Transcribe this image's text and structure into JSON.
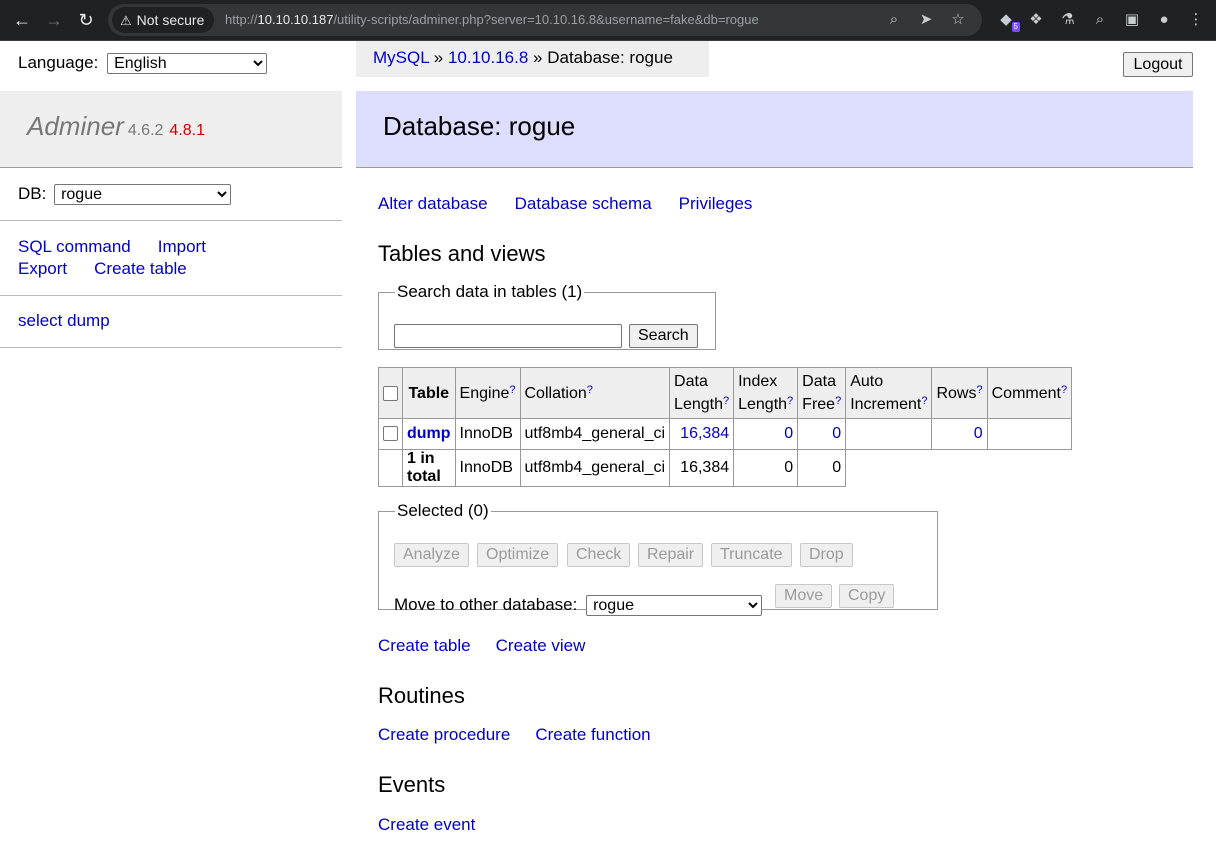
{
  "browser": {
    "security_label": "Not secure",
    "url_scheme": "http://",
    "url_host": "10.10.10.187",
    "url_path": "/utility-scripts/adminer.php?server=10.10.16.8&username=fake&db=rogue",
    "extension_badge": "5"
  },
  "language": {
    "label": "Language:",
    "selected": "English"
  },
  "breadcrumb": {
    "mysql": "MySQL",
    "sep1": " » ",
    "server": "10.10.16.8",
    "sep2": " » Database: rogue"
  },
  "logout_label": "Logout",
  "sidebar": {
    "brand": "Adminer",
    "version": "4.6.2",
    "new_version": "4.8.1",
    "db_label": "DB:",
    "db_selected": "rogue",
    "links": {
      "sql_command": "SQL command",
      "import": "Import",
      "export": "Export",
      "create_table": "Create table"
    },
    "select_dump": "select dump"
  },
  "content": {
    "heading": "Database: rogue",
    "top_links": {
      "alter": "Alter database",
      "schema": "Database schema",
      "privileges": "Privileges"
    },
    "tables_heading": "Tables and views",
    "search": {
      "legend": "Search data in tables (1)",
      "button": "Search",
      "value": ""
    },
    "table": {
      "headers": {
        "table": "Table",
        "engine": "Engine",
        "collation": "Collation",
        "data_length_1": "Data",
        "data_length_2": "Length",
        "index_length_1": "Index",
        "index_length_2": "Length",
        "data_free_1": "Data",
        "data_free_2": "Free",
        "auto_inc_1": "Auto",
        "auto_inc_2": "Increment",
        "rows": "Rows",
        "comment": "Comment",
        "help": "?"
      },
      "row": {
        "name": "dump",
        "engine": "InnoDB",
        "collation": "utf8mb4_general_ci",
        "data_length": "16,384",
        "index_length": "0",
        "data_free": "0",
        "auto_increment": "",
        "rows": "0",
        "comment": ""
      },
      "total": {
        "label": "1 in total",
        "engine": "InnoDB",
        "collation": "utf8mb4_general_ci",
        "data_length": "16,384",
        "index_length": "0",
        "data_free": "0"
      }
    },
    "selected": {
      "legend": "Selected (0)",
      "buttons": {
        "analyze": "Analyze",
        "optimize": "Optimize",
        "check": "Check",
        "repair": "Repair",
        "truncate": "Truncate",
        "drop": "Drop"
      },
      "move_label": "Move to other database:",
      "move_db": "rogue",
      "move": "Move",
      "copy": "Copy"
    },
    "create_links": {
      "table": "Create table",
      "view": "Create view"
    },
    "routines_heading": "Routines",
    "routine_links": {
      "procedure": "Create procedure",
      "function": "Create function"
    },
    "events_heading": "Events",
    "event_link": "Create event"
  }
}
